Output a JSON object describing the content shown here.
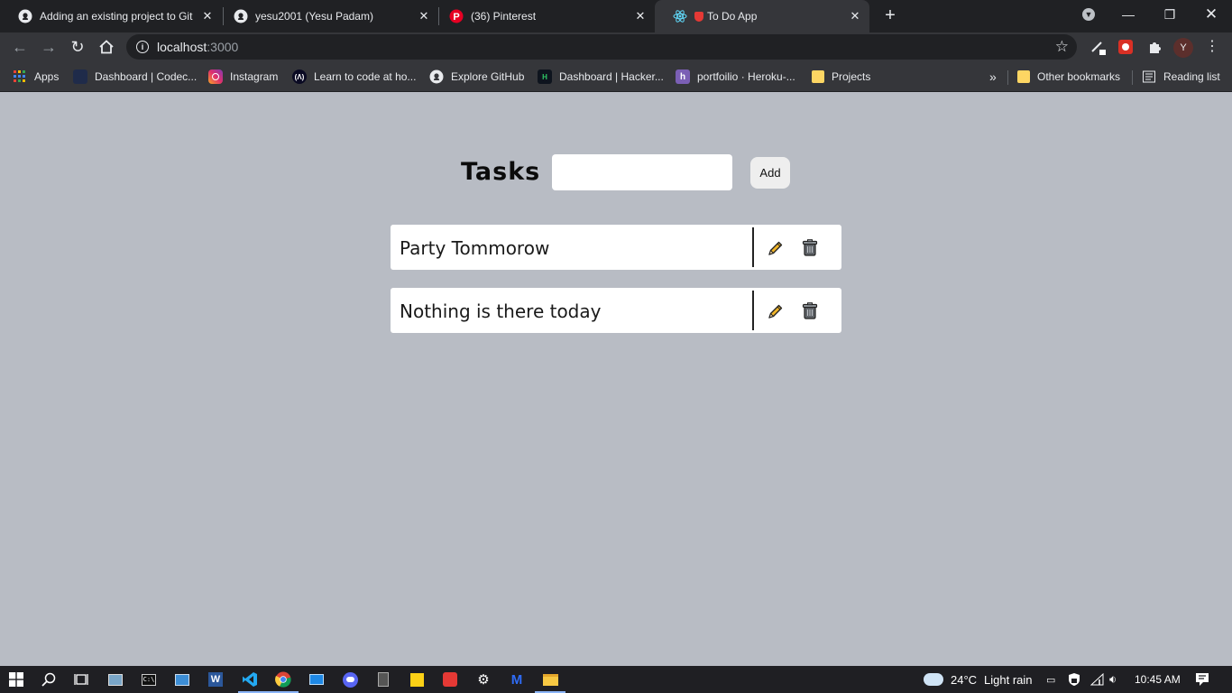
{
  "browser": {
    "tabs": [
      {
        "title": "Adding an existing project to Git",
        "icon": "github-icon"
      },
      {
        "title": "yesu2001 (Yesu Padam)",
        "icon": "github-icon"
      },
      {
        "title": "(36) Pinterest",
        "icon": "pinterest-icon"
      },
      {
        "title": "To Do App",
        "icon": "react-icon"
      }
    ],
    "url_host": "localhost",
    "url_port": ":3000",
    "profile_initial": "Y",
    "bookmarks": [
      {
        "label": "Apps",
        "icon": "apps-grid-icon"
      },
      {
        "label": "Dashboard | Codec...",
        "icon": "codecademy-icon"
      },
      {
        "label": "Instagram",
        "icon": "instagram-icon"
      },
      {
        "label": "Learn to code at ho...",
        "icon": "freecodecamp-icon"
      },
      {
        "label": "Explore GitHub",
        "icon": "github-icon"
      },
      {
        "label": "Dashboard | Hacker...",
        "icon": "hackerrank-icon"
      },
      {
        "label": "portfoilio · Heroku-...",
        "icon": "heroku-icon"
      },
      {
        "label": "Projects",
        "icon": "folder-icon"
      }
    ],
    "bookmarks_overflow": "»",
    "other_bookmarks": "Other bookmarks",
    "reading_list": "Reading list"
  },
  "app": {
    "heading": "Tasks",
    "input_value": "",
    "add_label": "Add",
    "tasks": [
      {
        "text": "Party Tommorow"
      },
      {
        "text": "Nothing is there today"
      }
    ],
    "colors": {
      "background": "#b8bcc4",
      "edit_pencil": "#f0b429",
      "trash": "#5f6368"
    }
  },
  "taskbar": {
    "weather_temp": "24°C",
    "weather_desc": "Light rain",
    "time": "10:45 AM"
  }
}
